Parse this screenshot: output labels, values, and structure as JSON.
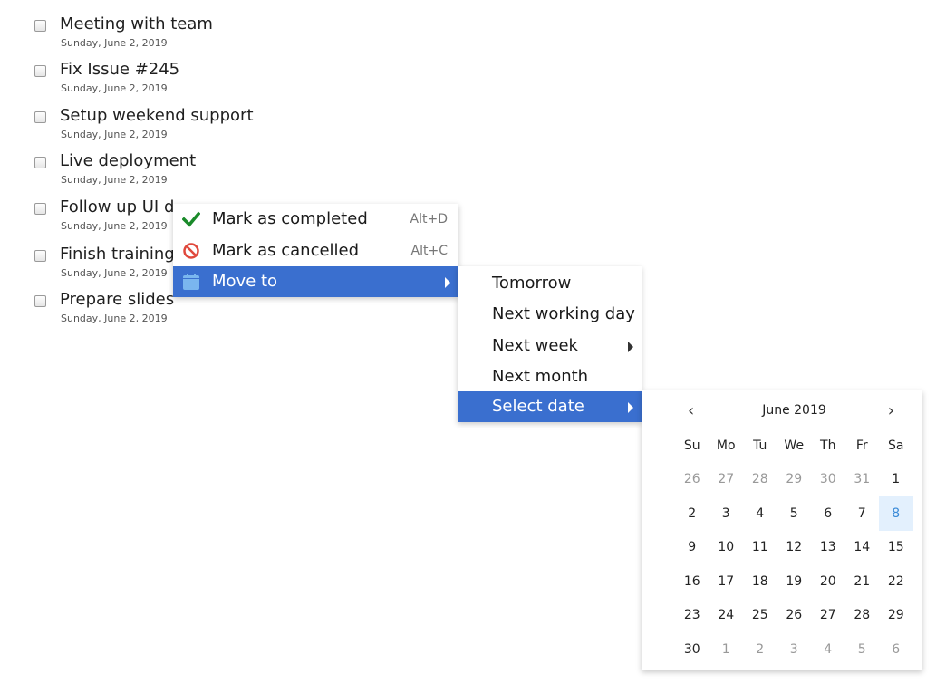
{
  "tasks": [
    {
      "title": "Meeting with team",
      "date": "Sunday, June 2, 2019"
    },
    {
      "title": "Fix Issue #245",
      "date": "Sunday, June 2, 2019"
    },
    {
      "title": "Setup weekend support",
      "date": "Sunday, June 2, 2019"
    },
    {
      "title": "Live deployment",
      "date": "Sunday, June 2, 2019"
    },
    {
      "title": "Follow up UI d",
      "date": "Sunday, June 2, 2019"
    },
    {
      "title": "Finish training",
      "date": "Sunday, June 2, 2019"
    },
    {
      "title": "Prepare slides",
      "date": "Sunday, June 2, 2019"
    }
  ],
  "context_menu": {
    "items": [
      {
        "label": "Mark as completed",
        "shortcut": "Alt+D",
        "icon": "checkmark-icon"
      },
      {
        "label": "Mark as cancelled",
        "shortcut": "Alt+C",
        "icon": "cancel-icon"
      },
      {
        "label": "Move to",
        "icon": "calendar-icon"
      }
    ]
  },
  "move_to_menu": {
    "items": [
      {
        "label": "Tomorrow"
      },
      {
        "label": "Next working day"
      },
      {
        "label": "Next week"
      },
      {
        "label": "Next month"
      },
      {
        "label": "Select date"
      }
    ]
  },
  "calendar": {
    "prev": "‹",
    "next": "›",
    "month_label": "June 2019",
    "weekdays": [
      "Su",
      "Mo",
      "Tu",
      "We",
      "Th",
      "Fr",
      "Sa"
    ],
    "weeks": [
      [
        "26",
        "27",
        "28",
        "29",
        "30",
        "31",
        "1"
      ],
      [
        "2",
        "3",
        "4",
        "5",
        "6",
        "7",
        "8"
      ],
      [
        "9",
        "10",
        "11",
        "12",
        "13",
        "14",
        "15"
      ],
      [
        "16",
        "17",
        "18",
        "19",
        "20",
        "21",
        "22"
      ],
      [
        "23",
        "24",
        "25",
        "26",
        "27",
        "28",
        "29"
      ],
      [
        "30",
        "1",
        "2",
        "3",
        "4",
        "5",
        "6"
      ]
    ],
    "selected_day": "8"
  },
  "colors": {
    "accent": "#3a6fcf",
    "check": "#1a8a2a",
    "cancel": "#e0483c",
    "calendar_icon": "#7ab6ef"
  }
}
